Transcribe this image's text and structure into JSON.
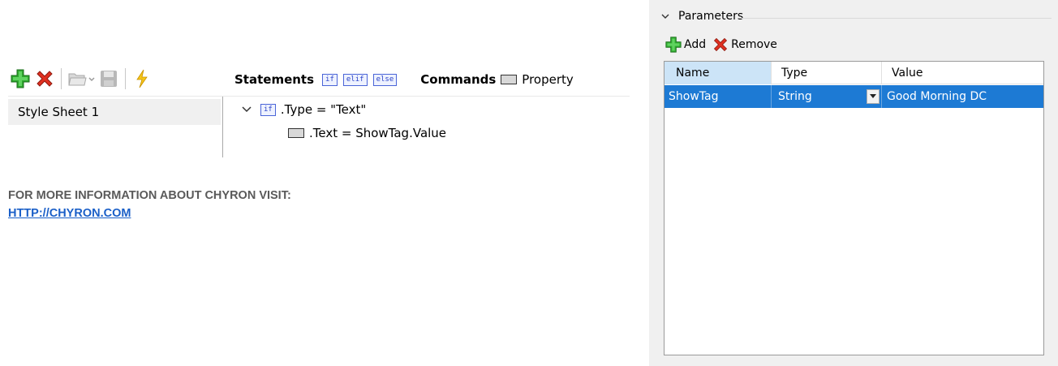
{
  "toolbar": {
    "icons": [
      "add-icon",
      "delete-icon",
      "open-folder-icon",
      "save-icon",
      "lightning-icon"
    ]
  },
  "statements_bar": {
    "statements_label": "Statements",
    "keywords": [
      "if",
      "elif",
      "else"
    ],
    "commands_label": "Commands",
    "property_label": "Property"
  },
  "style_sheets": {
    "items": [
      {
        "label": "Style Sheet 1"
      }
    ]
  },
  "tree": {
    "condition_keyword": "if",
    "condition_text": ".Type = \"Text\"",
    "command_text": ".Text = ShowTag.Value"
  },
  "info": {
    "line1": "FOR MORE INFORMATION ABOUT CHYRON VISIT:",
    "link": "HTTP://CHYRON.COM"
  },
  "parameters": {
    "title": "Parameters",
    "add_label": "Add",
    "remove_label": "Remove",
    "columns": [
      "Name",
      "Type",
      "Value"
    ],
    "rows": [
      {
        "name": "ShowTag",
        "type": "String",
        "value": "Good Morning DC"
      }
    ],
    "selection_color": "#1d7ad4"
  }
}
